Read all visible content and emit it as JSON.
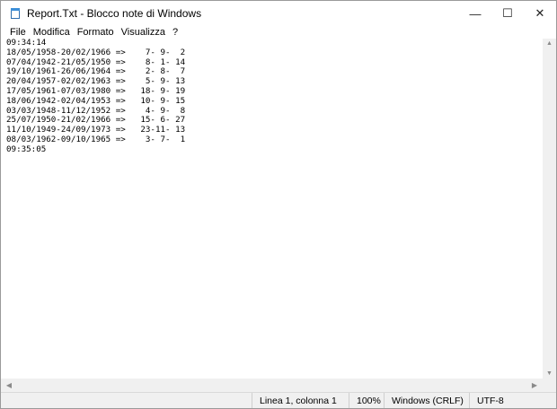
{
  "window": {
    "title": "Report.Txt - Blocco note di Windows",
    "controls": {
      "minimize": "—",
      "maximize": "☐",
      "close": "✕"
    }
  },
  "menu": [
    "File",
    "Modifica",
    "Formato",
    "Visualizza",
    "?"
  ],
  "document": {
    "content": "09:34:14\n18/05/1958-20/02/1966 =>    7- 9-  2\n07/04/1942-21/05/1950 =>    8- 1- 14\n19/10/1961-26/06/1964 =>    2- 8-  7\n20/04/1957-02/02/1963 =>    5- 9- 13\n17/05/1961-07/03/1980 =>   18- 9- 19\n18/06/1942-02/04/1953 =>   10- 9- 15\n03/03/1948-11/12/1952 =>    4- 9-  8\n25/07/1950-21/02/1966 =>   15- 6- 27\n11/10/1949-24/09/1973 =>   23-11- 13\n08/03/1962-09/10/1965 =>    3- 7-  1\n09:35:05"
  },
  "scrollbars": {
    "up": "▲",
    "down": "▼",
    "left": "◀",
    "right": "▶"
  },
  "status": {
    "position": "Linea 1, colonna 1",
    "zoom": "100%",
    "line_endings": "Windows (CRLF)",
    "encoding": "UTF-8"
  }
}
